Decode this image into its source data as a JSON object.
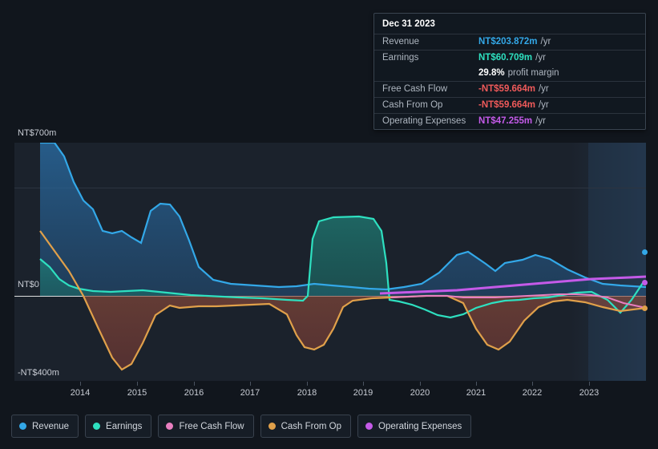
{
  "chart_data": {
    "type": "area",
    "title": "",
    "xlabel": "",
    "ylabel": "",
    "ylim": [
      -400,
      700
    ],
    "y_ticks": [
      {
        "label": "NT$700m",
        "value": 700
      },
      {
        "label": "NT$0",
        "value": 0
      },
      {
        "label": "-NT$400m",
        "value": -400
      }
    ],
    "x_ticks": [
      "2014",
      "2015",
      "2016",
      "2017",
      "2018",
      "2019",
      "2020",
      "2021",
      "2022",
      "2023"
    ],
    "grid": true,
    "legend_position": "bottom-left",
    "series": [
      {
        "name": "Revenue",
        "color": "#33a8e8",
        "x": [
          2013.0,
          2013.25,
          2013.5,
          2013.75,
          2014.0,
          2014.25,
          2014.5,
          2014.75,
          2015.0,
          2015.25,
          2015.5,
          2015.75,
          2016.0,
          2016.25,
          2016.5,
          2016.75,
          2017.0,
          2017.5,
          2018.0,
          2018.5,
          2019.0,
          2019.5,
          2020.0,
          2020.5,
          2021.0,
          2021.5,
          2022.0,
          2022.5,
          2023.0,
          2023.5,
          2023.9
        ],
        "values": [
          700,
          660,
          540,
          460,
          420,
          300,
          290,
          300,
          260,
          230,
          390,
          420,
          370,
          300,
          170,
          60,
          50,
          50,
          45,
          55,
          45,
          35,
          30,
          40,
          150,
          190,
          80,
          180,
          160,
          60,
          50
        ]
      },
      {
        "name": "Earnings",
        "color": "#2ee0c0",
        "x": [
          2013.0,
          2013.25,
          2013.5,
          2014.0,
          2014.5,
          2015.0,
          2015.5,
          2016.0,
          2016.5,
          2017.0,
          2017.5,
          2018.0,
          2018.3,
          2018.5,
          2019.0,
          2019.2,
          2019.5,
          2020.0,
          2020.5,
          2021.0,
          2021.5,
          2022.0,
          2022.5,
          2023.0,
          2023.5,
          2023.9
        ],
        "values": [
          170,
          140,
          60,
          30,
          25,
          20,
          30,
          25,
          5,
          -10,
          -10,
          -15,
          260,
          265,
          265,
          -10,
          -30,
          -40,
          -80,
          -60,
          -20,
          -10,
          -10,
          10,
          -60,
          60
        ]
      },
      {
        "name": "Free Cash Flow",
        "color": "#e87fc0",
        "x": [
          2020.0,
          2020.5,
          2021.0,
          2021.5,
          2022.0,
          2022.5,
          2023.0,
          2023.5,
          2023.9
        ],
        "values": [
          -10,
          -10,
          -5,
          0,
          0,
          5,
          5,
          -20,
          -60
        ]
      },
      {
        "name": "Cash From Op",
        "color": "#e0a04a",
        "x": [
          2013.0,
          2013.5,
          2014.0,
          2014.5,
          2015.0,
          2015.25,
          2015.5,
          2016.0,
          2016.5,
          2017.0,
          2017.5,
          2018.0,
          2018.4,
          2018.7,
          2019.0,
          2019.3,
          2019.6,
          2020.0,
          2020.5,
          2021.0,
          2021.5,
          2022.0,
          2022.3,
          2022.6,
          2023.0,
          2023.5,
          2023.9
        ],
        "values": [
          300,
          180,
          50,
          -120,
          -330,
          -360,
          -290,
          -50,
          -70,
          -60,
          -60,
          -55,
          -250,
          -290,
          -250,
          -30,
          -20,
          -15,
          -10,
          -5,
          0,
          -150,
          -250,
          -230,
          -100,
          -30,
          -60
        ]
      },
      {
        "name": "Operating Expenses",
        "color": "#c45ae8",
        "x": [
          2019.6,
          2020.0,
          2020.5,
          2021.0,
          2021.5,
          2022.0,
          2022.5,
          2023.0,
          2023.5,
          2023.9
        ],
        "values": [
          8,
          10,
          12,
          15,
          18,
          22,
          28,
          35,
          45,
          47
        ]
      }
    ]
  },
  "tooltip": {
    "title": "Dec 31 2023",
    "rows": [
      {
        "label": "Revenue",
        "value": "NT$203.872m",
        "suffix": "/yr",
        "color": "#33a8e8"
      },
      {
        "label": "Earnings",
        "value": "NT$60.709m",
        "suffix": "/yr",
        "color": "#2ee0c0"
      },
      {
        "label": "",
        "value": "29.8%",
        "suffix": "profit margin",
        "color": "#ffffff"
      },
      {
        "label": "Free Cash Flow",
        "value": "-NT$59.664m",
        "suffix": "/yr",
        "color": "#f05a5a"
      },
      {
        "label": "Cash From Op",
        "value": "-NT$59.664m",
        "suffix": "/yr",
        "color": "#f05a5a"
      },
      {
        "label": "Operating Expenses",
        "value": "NT$47.255m",
        "suffix": "/yr",
        "color": "#c45ae8"
      }
    ]
  },
  "legend": {
    "items": [
      {
        "label": "Revenue",
        "color": "#33a8e8"
      },
      {
        "label": "Earnings",
        "color": "#2ee0c0"
      },
      {
        "label": "Free Cash Flow",
        "color": "#e87fc0"
      },
      {
        "label": "Cash From Op",
        "color": "#e0a04a"
      },
      {
        "label": "Operating Expenses",
        "color": "#c45ae8"
      }
    ]
  },
  "axis": {
    "y_top_label": "NT$700m",
    "y_zero_label": "NT$0",
    "y_bottom_label": "-NT$400m"
  }
}
